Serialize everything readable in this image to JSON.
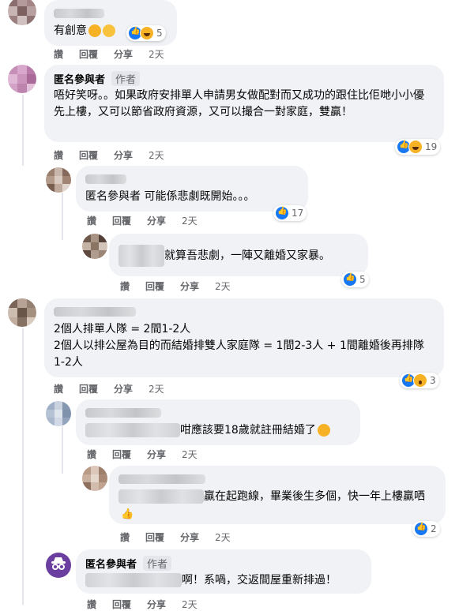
{
  "actions": {
    "like": "讚",
    "reply": "回覆",
    "share": "分享",
    "time": "2天"
  },
  "comments": [
    {
      "text": "有創意",
      "reactions": "5"
    },
    {
      "name": "匿名參與者",
      "badge": "作者",
      "text": "唔好笑呀。。如果政府安排單人申請男女做配對而又成功的跟住比佢哋小小優先上樓，又可以節省政府資源，又可以撮合一對家庭，雙贏！",
      "reactions": "19"
    },
    {
      "text": "匿名參與者 可能係悲劇既開始。。。",
      "reactions": "17"
    },
    {
      "text": "就算吾悲劇，一陣又離婚又家暴。",
      "reactions": "5"
    },
    {
      "text_line1": "2個人排單人隊 = 2間1-2人",
      "text_line2": "2個人以排公屋為目的而結婚排雙人家庭隊 = 1間2-3人 + 1間離婚後再排隊1-2人",
      "reactions": "3"
    },
    {
      "text": "咁應該要18歲就註冊結婚了",
      "reactions": ""
    },
    {
      "text": "贏在起跑線，畢業後生多個，快一年上樓贏哂",
      "reactions": "2"
    },
    {
      "name": "匿名參與者",
      "badge": "作者",
      "text": "啊！系喎，交返間屋重新排過！"
    }
  ],
  "colors": {
    "like": "#1877f2",
    "haha": "#f7b125",
    "bubble": "#f0f2f5"
  }
}
